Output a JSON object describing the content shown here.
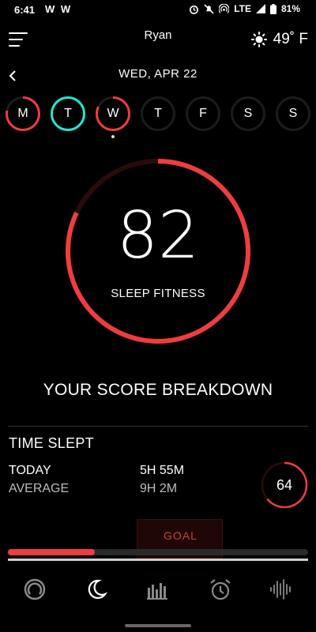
{
  "status_bar": {
    "time": "6:41",
    "notifications": "W W",
    "network": "LTE",
    "battery": "81%"
  },
  "header": {
    "menu_icon": "hamburger-menu-icon",
    "user_name": "Ryan",
    "weather_icon": "sun-icon",
    "temperature": "49˚ F"
  },
  "date_nav": {
    "back_icon": "chevron-left-icon",
    "date": "WED, APR 22"
  },
  "week_days": [
    {
      "label": "M",
      "ring_fraction": 0.78,
      "ring_color": "#ef3d3d"
    },
    {
      "label": "T",
      "ring_fraction": 1.0,
      "ring_color": "#1de9d4"
    },
    {
      "label": "W",
      "ring_fraction": 0.82,
      "ring_color": "#ef3d3d",
      "selected": true
    },
    {
      "label": "T",
      "ring_fraction": 0
    },
    {
      "label": "F",
      "ring_fraction": 0
    },
    {
      "label": "S",
      "ring_fraction": 0
    },
    {
      "label": "S",
      "ring_fraction": 0
    }
  ],
  "score": {
    "value": "82",
    "label": "SLEEP FITNESS",
    "fraction": 0.82,
    "color": "#ef3d3d"
  },
  "breakdown_title": "YOUR SCORE BREAKDOWN",
  "time_slept": {
    "title": "TIME SLEPT",
    "today_label": "TODAY",
    "today_value": "5H 55M",
    "average_label": "AVERAGE",
    "average_value": "9H 2M",
    "score": "64",
    "score_fraction": 0.64,
    "goal_label": "GOAL",
    "progress_fraction": 0.29
  },
  "bottom_nav": [
    {
      "icon": "recovery-ring-icon",
      "active": false
    },
    {
      "icon": "moon-icon",
      "active": true
    },
    {
      "icon": "bar-chart-icon",
      "active": false
    },
    {
      "icon": "alarm-clock-icon",
      "active": false
    },
    {
      "icon": "sound-wave-icon",
      "active": false
    }
  ]
}
